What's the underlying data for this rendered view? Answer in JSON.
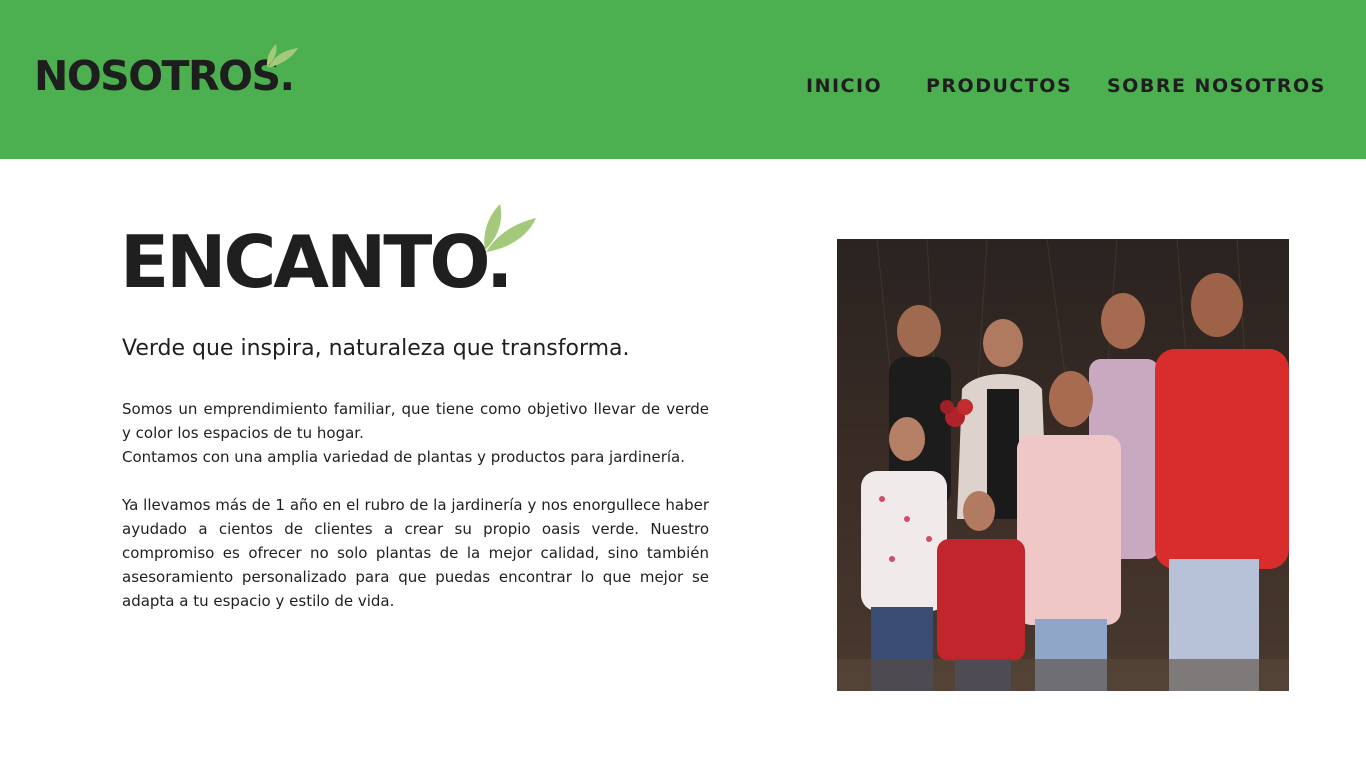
{
  "header": {
    "logo_text": "NOSOTROS.",
    "background_color": "#4caf50",
    "nav": {
      "inicio": "INICIO",
      "productos": "PRODUCTOS",
      "sobre_nosotros": "SOBRE NOSOTROS"
    }
  },
  "main": {
    "title": "ENCANTO.",
    "subtitle": "Verde que inspira, naturaleza que transforma.",
    "paragraph_1": "Somos un emprendimiento familiar, que tiene como objetivo llevar de verde y color los espacios de tu hogar.",
    "paragraph_2": "Contamos con una amplia variedad de plantas y productos para jardinería.",
    "paragraph_3": "Ya llevamos más de 1 año en el rubro de la jardinería y nos enorgullece haber ayudado a cientos de clientes a crear su propio oasis verde. Nuestro compromiso es ofrecer no solo plantas de la mejor calidad, sino también asesoramiento personalizado para que puedas encontrar lo que mejor se adapta a tu espacio y estilo de vida.",
    "leaf_color": "#a4c97a",
    "photo_icon": "family-photo"
  }
}
